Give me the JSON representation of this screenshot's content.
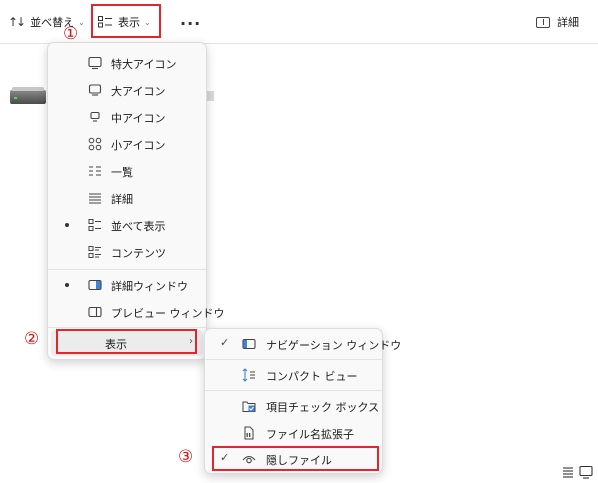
{
  "toolbar": {
    "sort_label": "並べ替え",
    "view_label": "表示",
    "more_label": "...",
    "details_label": "詳細"
  },
  "steps": {
    "one": "①",
    "two": "②",
    "three": "③"
  },
  "view_menu": {
    "items": [
      {
        "label": "特大アイコン",
        "icon": "monitor-icon",
        "selected": false
      },
      {
        "label": "大アイコン",
        "icon": "monitor-icon",
        "selected": false
      },
      {
        "label": "中アイコン",
        "icon": "small-monitor-icon",
        "selected": false
      },
      {
        "label": "小アイコン",
        "icon": "grid-icon",
        "selected": false
      },
      {
        "label": "一覧",
        "icon": "list-icon",
        "selected": false
      },
      {
        "label": "詳細",
        "icon": "details-list-icon",
        "selected": false
      },
      {
        "label": "並べて表示",
        "icon": "tiles-icon",
        "selected": true
      },
      {
        "label": "コンテンツ",
        "icon": "content-icon",
        "selected": false
      },
      {
        "label": "詳細ウィンドウ",
        "icon": "details-pane-icon",
        "selected": true
      },
      {
        "label": "プレビュー ウィンドウ",
        "icon": "preview-pane-icon",
        "selected": false
      },
      {
        "label": "表示",
        "icon": "",
        "selected": false,
        "has_submenu": true
      }
    ]
  },
  "show_submenu": {
    "items": [
      {
        "label": "ナビゲーション ウィンドウ",
        "icon": "nav-pane-icon",
        "checked": true
      },
      {
        "label": "コンパクト ビュー",
        "icon": "compact-view-icon",
        "checked": false
      },
      {
        "label": "項目チェック ボックス",
        "icon": "checkbox-folder-icon",
        "checked": false
      },
      {
        "label": "ファイル名拡張子",
        "icon": "file-extension-icon",
        "checked": false
      },
      {
        "label": "隠しファイル",
        "icon": "eye-icon",
        "checked": true
      }
    ]
  }
}
